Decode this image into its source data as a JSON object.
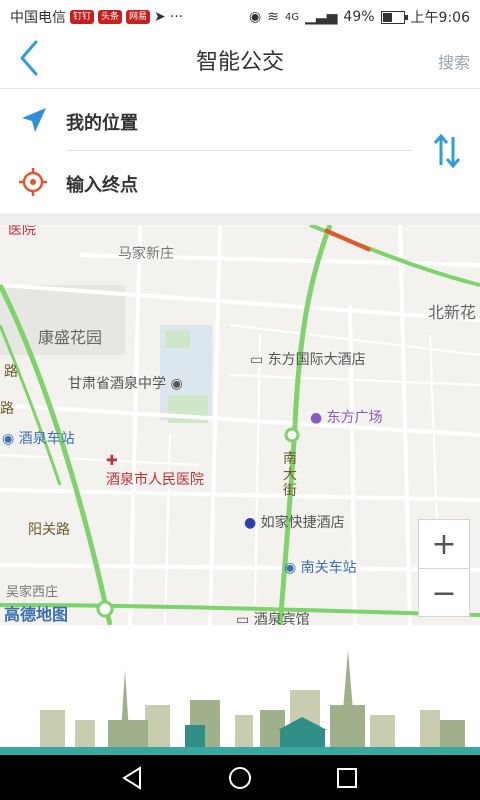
{
  "status": {
    "carrier": "中国电信",
    "badges": [
      "钉钉",
      "头条",
      "网易"
    ],
    "network": "4G",
    "battery": "49%",
    "battery_fraction": 0.49,
    "time": "上午9:06"
  },
  "header": {
    "title": "智能公交",
    "search_label": "搜索"
  },
  "route": {
    "origin_label": "我的位置",
    "destination_label": "输入终点"
  },
  "map": {
    "pois": {
      "majia": "马家新庄",
      "kangsheng": "康盛花园",
      "beixin": "北新花",
      "dongfang_hotel": "东方国际大酒店",
      "school": "甘肃省酒泉中学",
      "dongfang_square": "东方广场",
      "station": "酒泉车站",
      "hospital": "酒泉市人民医院",
      "nanda_street": "南大街",
      "rujia": "如家快捷酒店",
      "yangguan": "阳关路",
      "nanguan": "南关车站",
      "wujia": "吴家西庄",
      "gaode": "高德地图",
      "jiuquan_hotel": "酒泉宾馆",
      "road_left": "路",
      "road_left2": "路",
      "yiyuan": "医院"
    }
  },
  "colors": {
    "accent": "#2f9be0",
    "origin_icon": "#2f8ee0",
    "destination_icon": "#e8542c",
    "road_main": "#7fd36c"
  }
}
